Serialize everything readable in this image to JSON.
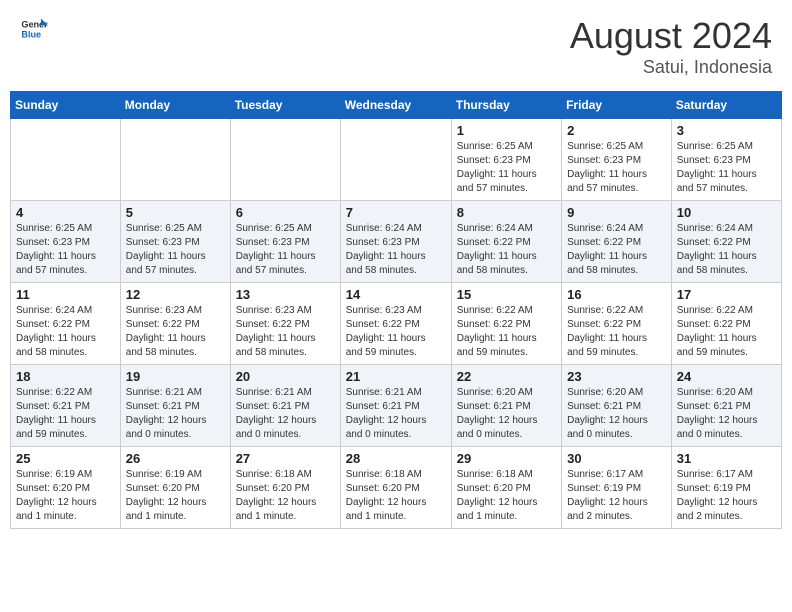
{
  "header": {
    "logo_text_general": "General",
    "logo_text_blue": "Blue",
    "month_year": "August 2024",
    "location": "Satui, Indonesia"
  },
  "calendar": {
    "headers": [
      "Sunday",
      "Monday",
      "Tuesday",
      "Wednesday",
      "Thursday",
      "Friday",
      "Saturday"
    ],
    "weeks": [
      [
        {
          "day": "",
          "info": ""
        },
        {
          "day": "",
          "info": ""
        },
        {
          "day": "",
          "info": ""
        },
        {
          "day": "",
          "info": ""
        },
        {
          "day": "1",
          "info": "Sunrise: 6:25 AM\nSunset: 6:23 PM\nDaylight: 11 hours\nand 57 minutes."
        },
        {
          "day": "2",
          "info": "Sunrise: 6:25 AM\nSunset: 6:23 PM\nDaylight: 11 hours\nand 57 minutes."
        },
        {
          "day": "3",
          "info": "Sunrise: 6:25 AM\nSunset: 6:23 PM\nDaylight: 11 hours\nand 57 minutes."
        }
      ],
      [
        {
          "day": "4",
          "info": "Sunrise: 6:25 AM\nSunset: 6:23 PM\nDaylight: 11 hours\nand 57 minutes."
        },
        {
          "day": "5",
          "info": "Sunrise: 6:25 AM\nSunset: 6:23 PM\nDaylight: 11 hours\nand 57 minutes."
        },
        {
          "day": "6",
          "info": "Sunrise: 6:25 AM\nSunset: 6:23 PM\nDaylight: 11 hours\nand 57 minutes."
        },
        {
          "day": "7",
          "info": "Sunrise: 6:24 AM\nSunset: 6:23 PM\nDaylight: 11 hours\nand 58 minutes."
        },
        {
          "day": "8",
          "info": "Sunrise: 6:24 AM\nSunset: 6:22 PM\nDaylight: 11 hours\nand 58 minutes."
        },
        {
          "day": "9",
          "info": "Sunrise: 6:24 AM\nSunset: 6:22 PM\nDaylight: 11 hours\nand 58 minutes."
        },
        {
          "day": "10",
          "info": "Sunrise: 6:24 AM\nSunset: 6:22 PM\nDaylight: 11 hours\nand 58 minutes."
        }
      ],
      [
        {
          "day": "11",
          "info": "Sunrise: 6:24 AM\nSunset: 6:22 PM\nDaylight: 11 hours\nand 58 minutes."
        },
        {
          "day": "12",
          "info": "Sunrise: 6:23 AM\nSunset: 6:22 PM\nDaylight: 11 hours\nand 58 minutes."
        },
        {
          "day": "13",
          "info": "Sunrise: 6:23 AM\nSunset: 6:22 PM\nDaylight: 11 hours\nand 58 minutes."
        },
        {
          "day": "14",
          "info": "Sunrise: 6:23 AM\nSunset: 6:22 PM\nDaylight: 11 hours\nand 59 minutes."
        },
        {
          "day": "15",
          "info": "Sunrise: 6:22 AM\nSunset: 6:22 PM\nDaylight: 11 hours\nand 59 minutes."
        },
        {
          "day": "16",
          "info": "Sunrise: 6:22 AM\nSunset: 6:22 PM\nDaylight: 11 hours\nand 59 minutes."
        },
        {
          "day": "17",
          "info": "Sunrise: 6:22 AM\nSunset: 6:22 PM\nDaylight: 11 hours\nand 59 minutes."
        }
      ],
      [
        {
          "day": "18",
          "info": "Sunrise: 6:22 AM\nSunset: 6:21 PM\nDaylight: 11 hours\nand 59 minutes."
        },
        {
          "day": "19",
          "info": "Sunrise: 6:21 AM\nSunset: 6:21 PM\nDaylight: 12 hours\nand 0 minutes."
        },
        {
          "day": "20",
          "info": "Sunrise: 6:21 AM\nSunset: 6:21 PM\nDaylight: 12 hours\nand 0 minutes."
        },
        {
          "day": "21",
          "info": "Sunrise: 6:21 AM\nSunset: 6:21 PM\nDaylight: 12 hours\nand 0 minutes."
        },
        {
          "day": "22",
          "info": "Sunrise: 6:20 AM\nSunset: 6:21 PM\nDaylight: 12 hours\nand 0 minutes."
        },
        {
          "day": "23",
          "info": "Sunrise: 6:20 AM\nSunset: 6:21 PM\nDaylight: 12 hours\nand 0 minutes."
        },
        {
          "day": "24",
          "info": "Sunrise: 6:20 AM\nSunset: 6:21 PM\nDaylight: 12 hours\nand 0 minutes."
        }
      ],
      [
        {
          "day": "25",
          "info": "Sunrise: 6:19 AM\nSunset: 6:20 PM\nDaylight: 12 hours\nand 1 minute."
        },
        {
          "day": "26",
          "info": "Sunrise: 6:19 AM\nSunset: 6:20 PM\nDaylight: 12 hours\nand 1 minute."
        },
        {
          "day": "27",
          "info": "Sunrise: 6:18 AM\nSunset: 6:20 PM\nDaylight: 12 hours\nand 1 minute."
        },
        {
          "day": "28",
          "info": "Sunrise: 6:18 AM\nSunset: 6:20 PM\nDaylight: 12 hours\nand 1 minute."
        },
        {
          "day": "29",
          "info": "Sunrise: 6:18 AM\nSunset: 6:20 PM\nDaylight: 12 hours\nand 1 minute."
        },
        {
          "day": "30",
          "info": "Sunrise: 6:17 AM\nSunset: 6:19 PM\nDaylight: 12 hours\nand 2 minutes."
        },
        {
          "day": "31",
          "info": "Sunrise: 6:17 AM\nSunset: 6:19 PM\nDaylight: 12 hours\nand 2 minutes."
        }
      ]
    ]
  }
}
